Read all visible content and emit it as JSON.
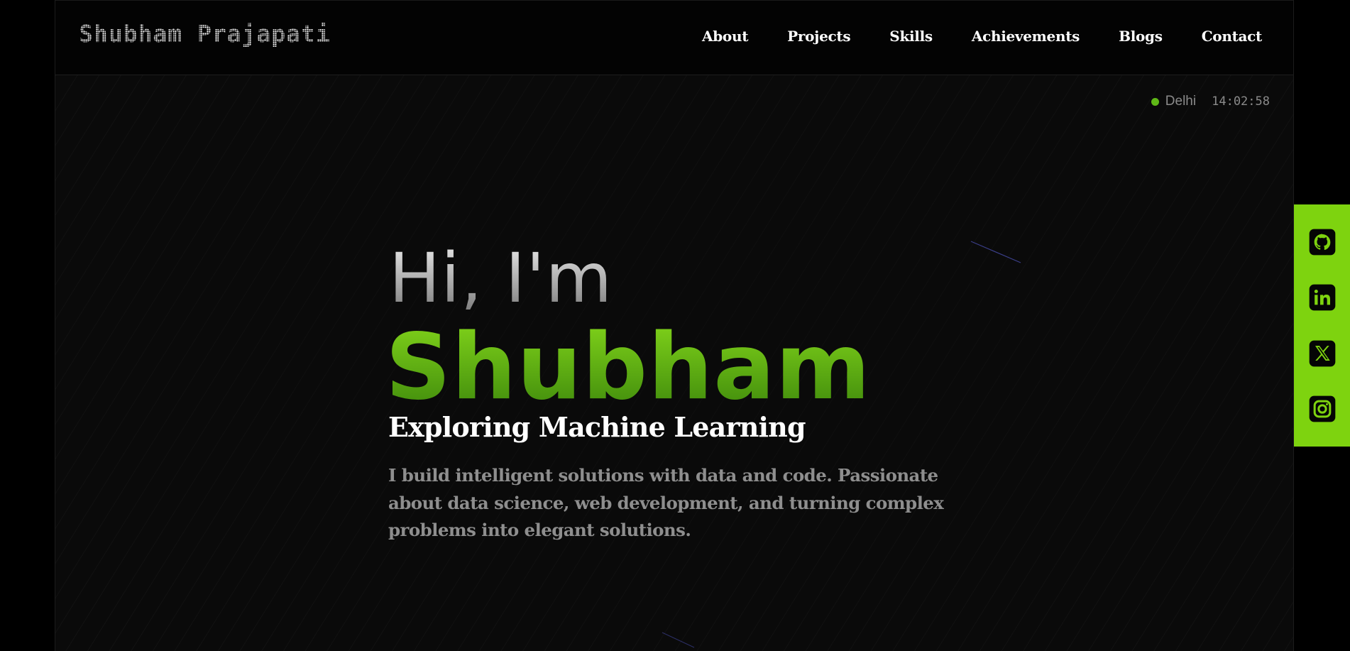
{
  "header": {
    "brand": "Shubham Prajapati",
    "nav": [
      {
        "label": "About"
      },
      {
        "label": "Projects"
      },
      {
        "label": "Skills"
      },
      {
        "label": "Achievements"
      },
      {
        "label": "Blogs"
      },
      {
        "label": "Contact"
      }
    ]
  },
  "status": {
    "city": "Delhi",
    "time": "14:02:58",
    "indicator_color": "#5fb817"
  },
  "hero": {
    "greeting": "Hi, I'm",
    "name": "Shubham",
    "tagline": "Exploring Machine Learning",
    "bio": "I build intelligent solutions with data and code. Passionate about data science, web development, and turning complex problems into elegant solutions."
  },
  "social": {
    "accent_color": "#7ed30f",
    "links": [
      {
        "icon": "github-icon"
      },
      {
        "icon": "linkedin-icon"
      },
      {
        "icon": "x-icon"
      },
      {
        "icon": "instagram-icon"
      }
    ]
  }
}
